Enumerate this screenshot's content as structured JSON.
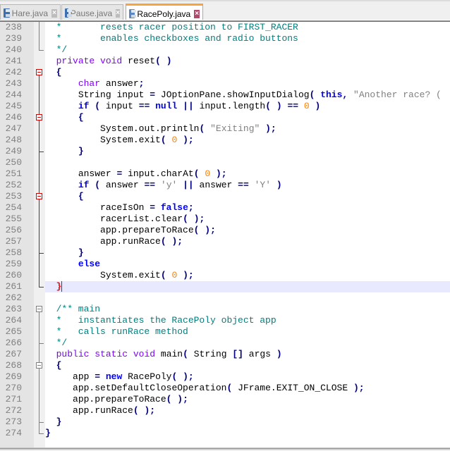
{
  "tabs": [
    {
      "label": "Hare.java",
      "active": false,
      "icon": "save-icon",
      "close": "×"
    },
    {
      "label": "Pause.java",
      "active": false,
      "icon": "save-icon",
      "close": "×"
    },
    {
      "label": "RacePoly.java",
      "active": true,
      "icon": "save-icon",
      "close": "×"
    }
  ],
  "editor": {
    "current_line": "261",
    "lines": [
      {
        "num": "238",
        "text": "  *       resets racer position to FIRST_RACER"
      },
      {
        "num": "239",
        "text": "  *       enables checkboxes and radio buttons"
      },
      {
        "num": "240",
        "text": "  */"
      },
      {
        "num": "241",
        "text": "  private void reset( )"
      },
      {
        "num": "242",
        "text": "  {"
      },
      {
        "num": "243",
        "text": "      char answer;"
      },
      {
        "num": "244",
        "text": "      String input = JOptionPane.showInputDialog( this, \"Another race? ("
      },
      {
        "num": "245",
        "text": "      if ( input == null || input.length( ) == 0 )"
      },
      {
        "num": "246",
        "text": "      {"
      },
      {
        "num": "247",
        "text": "          System.out.println( \"Exiting\" );"
      },
      {
        "num": "248",
        "text": "          System.exit( 0 );"
      },
      {
        "num": "249",
        "text": "      }"
      },
      {
        "num": "250",
        "text": ""
      },
      {
        "num": "251",
        "text": "      answer = input.charAt( 0 );"
      },
      {
        "num": "252",
        "text": "      if ( answer == 'y' || answer == 'Y' )"
      },
      {
        "num": "253",
        "text": "      {"
      },
      {
        "num": "254",
        "text": "          raceIsOn = false;"
      },
      {
        "num": "255",
        "text": "          racerList.clear( );"
      },
      {
        "num": "256",
        "text": "          app.prepareToRace( );"
      },
      {
        "num": "257",
        "text": "          app.runRace( );"
      },
      {
        "num": "258",
        "text": "      }"
      },
      {
        "num": "259",
        "text": "      else"
      },
      {
        "num": "260",
        "text": "          System.exit( 0 );"
      },
      {
        "num": "261",
        "text": "  }"
      },
      {
        "num": "262",
        "text": ""
      },
      {
        "num": "263",
        "text": "  /** main"
      },
      {
        "num": "264",
        "text": "  *   instantiates the RacePoly object app"
      },
      {
        "num": "265",
        "text": "  *   calls runRace method"
      },
      {
        "num": "266",
        "text": "  */"
      },
      {
        "num": "267",
        "text": "  public static void main( String [] args )"
      },
      {
        "num": "268",
        "text": "  {"
      },
      {
        "num": "269",
        "text": "     app = new RacePoly( );"
      },
      {
        "num": "270",
        "text": "     app.setDefaultCloseOperation( JFrame.EXIT_ON_CLOSE );"
      },
      {
        "num": "271",
        "text": "     app.prepareToRace( );"
      },
      {
        "num": "272",
        "text": "     app.runRace( );"
      },
      {
        "num": "273",
        "text": "  }"
      },
      {
        "num": "274",
        "text": "}"
      }
    ]
  },
  "syntax_colors": {
    "comment": "#008080",
    "keyword": "#0000ff",
    "type": "#8000ff",
    "operator": "#000080",
    "number": "#ff8000",
    "string": "#808080"
  }
}
